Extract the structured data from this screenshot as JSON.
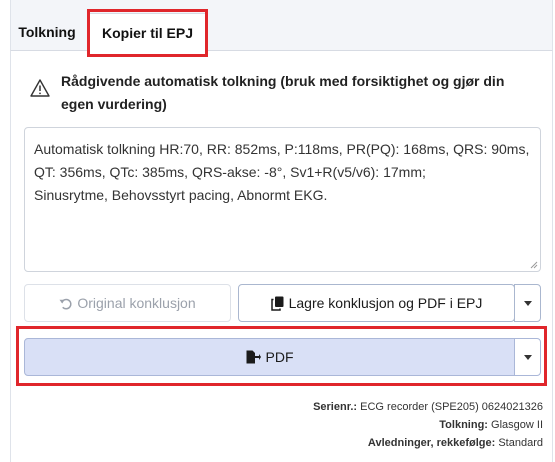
{
  "tabs": [
    {
      "label": "Tolkning",
      "active": false
    },
    {
      "label": "Kopier til EPJ",
      "active": true
    }
  ],
  "warning": {
    "icon": "warning-triangle-icon",
    "text": "Rådgivende automatisk tolkning (bruk med forsiktighet og gjør din egen vurdering)"
  },
  "interpretation": {
    "text": "Automatisk tolkning HR:70, RR: 852ms, P:118ms, PR(PQ): 168ms, QRS: 90ms, QT: 356ms, QTc: 385ms, QRS-akse: -8°, Sv1+R(v5/v6): 17mm;\nSinusrytme, Behovsstyrt pacing, Abnormt EKG."
  },
  "buttons": {
    "original_label": "Original konklusjon",
    "original_icon": "undo-icon",
    "lagre_label": "Lagre konklusjon og PDF i EPJ",
    "lagre_icon": "copy-icon",
    "pdf_label": "PDF",
    "pdf_icon": "file-export-icon"
  },
  "meta": {
    "serial_label": "Serienr.:",
    "serial_value": "ECG recorder (SPE205) 0624021326",
    "tolkning_label": "Tolkning:",
    "tolkning_value": "Glasgow II",
    "leads_label": "Avledninger, rekkefølge:",
    "leads_value": "Standard"
  },
  "colors": {
    "highlight": "#e0262b",
    "pdf_button_bg": "#d9e0f6",
    "tab_bar_bg": "#f3f5f9"
  }
}
